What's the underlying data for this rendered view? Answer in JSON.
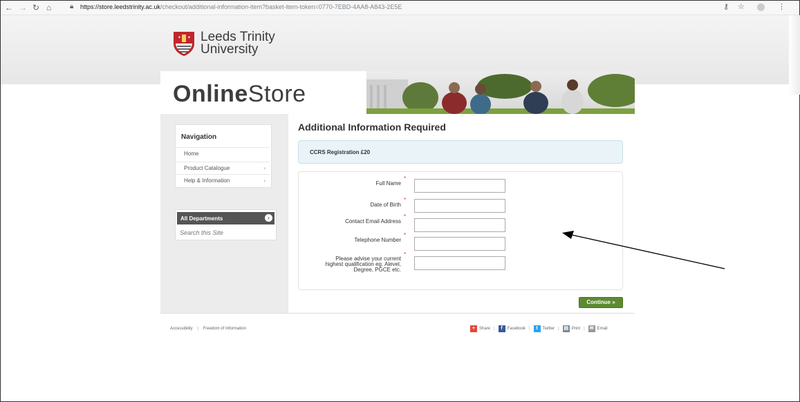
{
  "browser": {
    "url_domain": "https://store.leedstrinity.ac.uk",
    "url_path": "/checkout/additional-information-item?basket-item-token=0770-7EBD-4AA8-A843-2E5E",
    "back_icon": "back-arrow-icon",
    "forward_icon": "forward-arrow-icon",
    "reload_icon": "reload-icon",
    "home_icon": "home-icon"
  },
  "logo": {
    "line1": "Leeds Trinity",
    "line2": "University"
  },
  "banner": {
    "title_bold": "Online",
    "title_light": "Store"
  },
  "sidebar": {
    "heading": "Navigation",
    "items": [
      {
        "label": "Home",
        "arrow": ""
      },
      {
        "label": "Product Catalogue",
        "arrow": "›"
      },
      {
        "label": "Help & Information",
        "arrow": "›"
      }
    ],
    "departments": {
      "label": "All Departments",
      "search_placeholder": "Search this Site"
    }
  },
  "main": {
    "title": "Additional Information Required",
    "item": "CCRS Registration £20",
    "fields": [
      {
        "label": "Full Name",
        "value": ""
      },
      {
        "label": "Date of Birth",
        "value": ""
      },
      {
        "label": "Contact Email Address",
        "value": ""
      },
      {
        "label": "Telephone Number",
        "value": ""
      },
      {
        "label_lines": [
          "Please advise your current",
          "highest qualification eg. Alevel,",
          "Degree, PGCE etc."
        ],
        "value": ""
      }
    ],
    "required_mark": "*",
    "continue_label": "Continue »"
  },
  "footer": {
    "links": [
      "Accessibility",
      "Freedom of Information"
    ],
    "separator": "|",
    "share": [
      "Share",
      "Facebook",
      "Twitter",
      "Print",
      "Email"
    ]
  },
  "colors": {
    "continue": "#5c8a31",
    "required": "#d33333",
    "info_bg": "#e9f3f8"
  }
}
